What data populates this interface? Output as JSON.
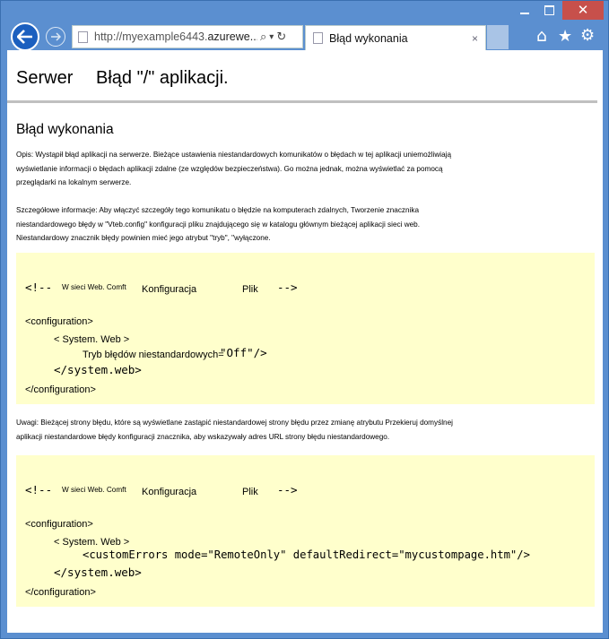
{
  "browser": {
    "url_prefix": "http://myexample6443.",
    "url_domain": "azurewe...",
    "tab_title": "Błąd wykonania",
    "tab_close": "×",
    "close_glyph": "✕",
    "home_glyph": "⌂",
    "star_glyph": "★",
    "gear_glyph": "⚙",
    "search_glyph": "⌕",
    "dropdown_glyph": "▾",
    "refresh_glyph": "↻"
  },
  "page": {
    "server_label": "Serwer",
    "app_error_title": "Błąd \"/\" aplikacji.",
    "runtime_error_title": "Błąd wykonania",
    "description": [
      "Opis: Wystąpił błąd aplikacji na serwerze. Bieżące ustawienia niestandardowych komunikatów o błędach w tej aplikacji uniemożliwiają",
      "wyświetlanie informacji o błędach aplikacji zdalne (ze względów bezpieczeństwa). Go można jednak, można wyświetlać za pomocą",
      "przeglądarki na lokalnym serwerze."
    ],
    "details": [
      "Szczegółowe informacje: Aby włączyć szczegóły tego komunikatu o błędzie na komputerach zdalnych, Tworzenie znacznika",
      "niestandardowego błędy w \"Vteb.config\" konfiguracji pliku znajdującego się w katalogu głównym  bieżącej aplikacji sieci web.",
      "Niestandardowy znacznik błędy powinien mieć jego atrybut \"tryb\", \"wyłączone."
    ],
    "note": [
      "Uwagi: Bieżącej strony błędu, które są wyświetlane zastąpić niestandardowej strony błędu przez zmianę atrybutu Przekieruj domyślnej",
      "aplikacji niestandardowe błędy konfiguracji znacznika, aby wskazywały adres URL strony błędu niestandardowego."
    ]
  },
  "code1": {
    "comment_open": "<!--",
    "comment_a": "W sieci Web. Comft",
    "comment_b": "Konfiguracja",
    "comment_c": "Plik",
    "comment_close": "-->",
    "configuration_open": "<configuration>",
    "system_web_open": "< System. Web >",
    "mode_text": "Tryb błędów niestandardowych=",
    "mode_value": "\"Off\"/>",
    "system_web_close": "</system.web>",
    "configuration_close": "</configuration>"
  },
  "code2": {
    "comment_open": "<!--",
    "comment_a": "W sieci Web. Comft",
    "comment_b": "Konfiguracja",
    "comment_c": "Plik",
    "comment_close": "-->",
    "configuration_open": "<configuration>",
    "system_web_open": "< System. Web >",
    "custom_errors": "<customErrors mode=\"RemoteOnly\" defaultRedirect=\"mycustompage.htm\"/>",
    "system_web_close": "</system.web>",
    "configuration_close": "</configuration>"
  }
}
